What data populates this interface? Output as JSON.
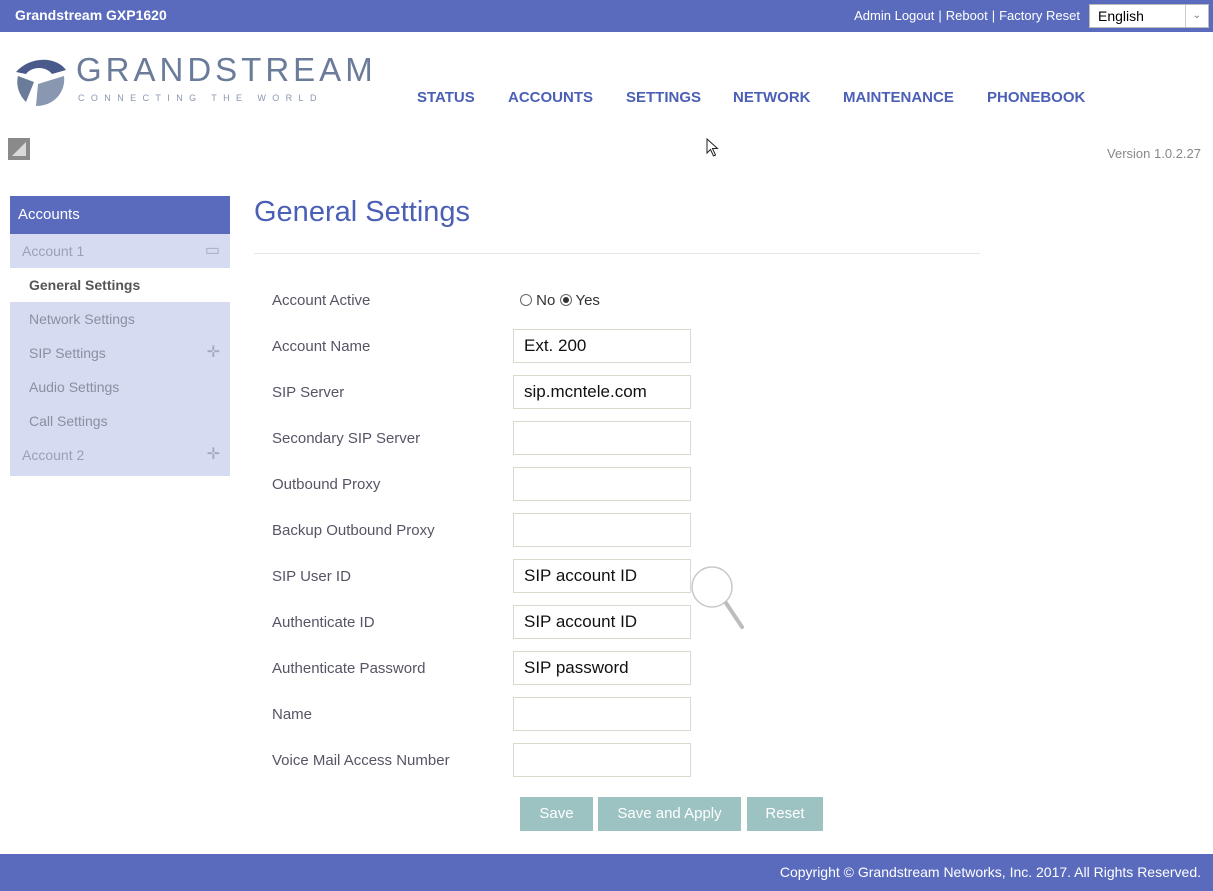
{
  "topbar": {
    "model": "Grandstream GXP1620",
    "admin_logout": "Admin Logout",
    "reboot": "Reboot",
    "factory_reset": "Factory Reset",
    "separator": "|",
    "language": "English"
  },
  "logo": {
    "word": "GRANDSTREAM",
    "tagline": "CONNECTING THE WORLD"
  },
  "nav": {
    "status": "STATUS",
    "accounts": "ACCOUNTS",
    "settings": "SETTINGS",
    "network": "NETWORK",
    "maintenance": "MAINTENANCE",
    "phonebook": "PHONEBOOK"
  },
  "version": "Version 1.0.2.27",
  "sidebar": {
    "header": "Accounts",
    "account1": "Account 1",
    "general": "General Settings",
    "network": "Network Settings",
    "sip": "SIP Settings",
    "audio": "Audio Settings",
    "call": "Call Settings",
    "account2": "Account 2"
  },
  "page": {
    "title": "General Settings"
  },
  "form": {
    "account_active": {
      "label": "Account Active",
      "no": "No",
      "yes": "Yes",
      "selected": "Yes"
    },
    "account_name": {
      "label": "Account Name",
      "value": "Ext. 200"
    },
    "sip_server": {
      "label": "SIP Server",
      "value": "sip.mcntele.com"
    },
    "secondary_sip_server": {
      "label": "Secondary SIP Server",
      "value": ""
    },
    "outbound_proxy": {
      "label": "Outbound Proxy",
      "value": ""
    },
    "backup_outbound_proxy": {
      "label": "Backup Outbound Proxy",
      "value": ""
    },
    "sip_user_id": {
      "label": "SIP User ID",
      "value": "SIP account ID"
    },
    "authenticate_id": {
      "label": "Authenticate ID",
      "value": "SIP account ID"
    },
    "authenticate_password": {
      "label": "Authenticate Password",
      "value": "SIP password"
    },
    "name": {
      "label": "Name",
      "value": ""
    },
    "voice_mail": {
      "label": "Voice Mail Access Number",
      "value": ""
    }
  },
  "buttons": {
    "save": "Save",
    "save_apply": "Save and Apply",
    "reset": "Reset"
  },
  "footer": {
    "copyright": "Copyright © Grandstream Networks, Inc. 2017. All Rights Reserved."
  },
  "colors": {
    "brand_blue": "#5a6bbd",
    "nav_blue": "#4a5fb5",
    "sidebar_bg": "#d6dbf1",
    "button_teal": "#9cc2c2"
  }
}
